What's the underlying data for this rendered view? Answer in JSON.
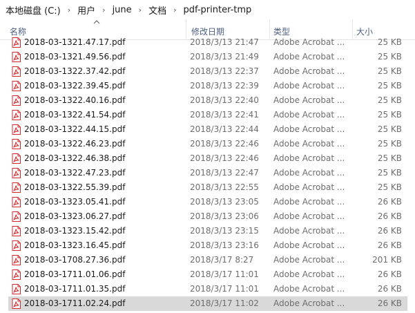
{
  "breadcrumb": [
    "本地磁盘 (C:)",
    "用户",
    "june",
    "文档",
    "pdf-printer-tmp"
  ],
  "breadcrumb_separator": "›",
  "columns": {
    "name": "名称",
    "date": "修改日期",
    "type": "类型",
    "size": "大小"
  },
  "files": [
    {
      "name": "2018-03-1321.47.17.pdf",
      "date": "2018/3/13 21:47",
      "type": "Adobe Acrobat ...",
      "size": "25 KB"
    },
    {
      "name": "2018-03-1321.49.56.pdf",
      "date": "2018/3/13 21:49",
      "type": "Adobe Acrobat ...",
      "size": "25 KB"
    },
    {
      "name": "2018-03-1322.37.42.pdf",
      "date": "2018/3/13 22:37",
      "type": "Adobe Acrobat ...",
      "size": "25 KB"
    },
    {
      "name": "2018-03-1322.39.45.pdf",
      "date": "2018/3/13 22:39",
      "type": "Adobe Acrobat ...",
      "size": "25 KB"
    },
    {
      "name": "2018-03-1322.40.16.pdf",
      "date": "2018/3/13 22:40",
      "type": "Adobe Acrobat ...",
      "size": "25 KB"
    },
    {
      "name": "2018-03-1322.41.54.pdf",
      "date": "2018/3/13 22:41",
      "type": "Adobe Acrobat ...",
      "size": "25 KB"
    },
    {
      "name": "2018-03-1322.44.15.pdf",
      "date": "2018/3/13 22:44",
      "type": "Adobe Acrobat ...",
      "size": "25 KB"
    },
    {
      "name": "2018-03-1322.46.23.pdf",
      "date": "2018/3/13 22:46",
      "type": "Adobe Acrobat ...",
      "size": "25 KB"
    },
    {
      "name": "2018-03-1322.46.38.pdf",
      "date": "2018/3/13 22:46",
      "type": "Adobe Acrobat ...",
      "size": "25 KB"
    },
    {
      "name": "2018-03-1322.47.23.pdf",
      "date": "2018/3/13 22:47",
      "type": "Adobe Acrobat ...",
      "size": "25 KB"
    },
    {
      "name": "2018-03-1322.55.39.pdf",
      "date": "2018/3/13 22:55",
      "type": "Adobe Acrobat ...",
      "size": "25 KB"
    },
    {
      "name": "2018-03-1323.05.41.pdf",
      "date": "2018/3/13 23:05",
      "type": "Adobe Acrobat ...",
      "size": "26 KB"
    },
    {
      "name": "2018-03-1323.06.27.pdf",
      "date": "2018/3/13 23:06",
      "type": "Adobe Acrobat ...",
      "size": "26 KB"
    },
    {
      "name": "2018-03-1323.15.42.pdf",
      "date": "2018/3/13 23:15",
      "type": "Adobe Acrobat ...",
      "size": "26 KB"
    },
    {
      "name": "2018-03-1323.16.45.pdf",
      "date": "2018/3/13 23:16",
      "type": "Adobe Acrobat ...",
      "size": "26 KB"
    },
    {
      "name": "2018-03-1708.27.36.pdf",
      "date": "2018/3/17 8:27",
      "type": "Adobe Acrobat ...",
      "size": "201 KB"
    },
    {
      "name": "2018-03-1711.01.06.pdf",
      "date": "2018/3/17 11:01",
      "type": "Adobe Acrobat ...",
      "size": "26 KB"
    },
    {
      "name": "2018-03-1711.01.35.pdf",
      "date": "2018/3/17 11:01",
      "type": "Adobe Acrobat ...",
      "size": "26 KB"
    },
    {
      "name": "2018-03-1711.02.24.pdf",
      "date": "2018/3/17 11:02",
      "type": "Adobe Acrobat ...",
      "size": "26 KB",
      "selected": true
    }
  ],
  "icons": {
    "file": "pdf-file-icon",
    "sort": "sort-ascending-icon"
  },
  "colors": {
    "pdf_red": "#d9262b",
    "selection": "#d9d9d9",
    "header_text": "#4d6082"
  }
}
